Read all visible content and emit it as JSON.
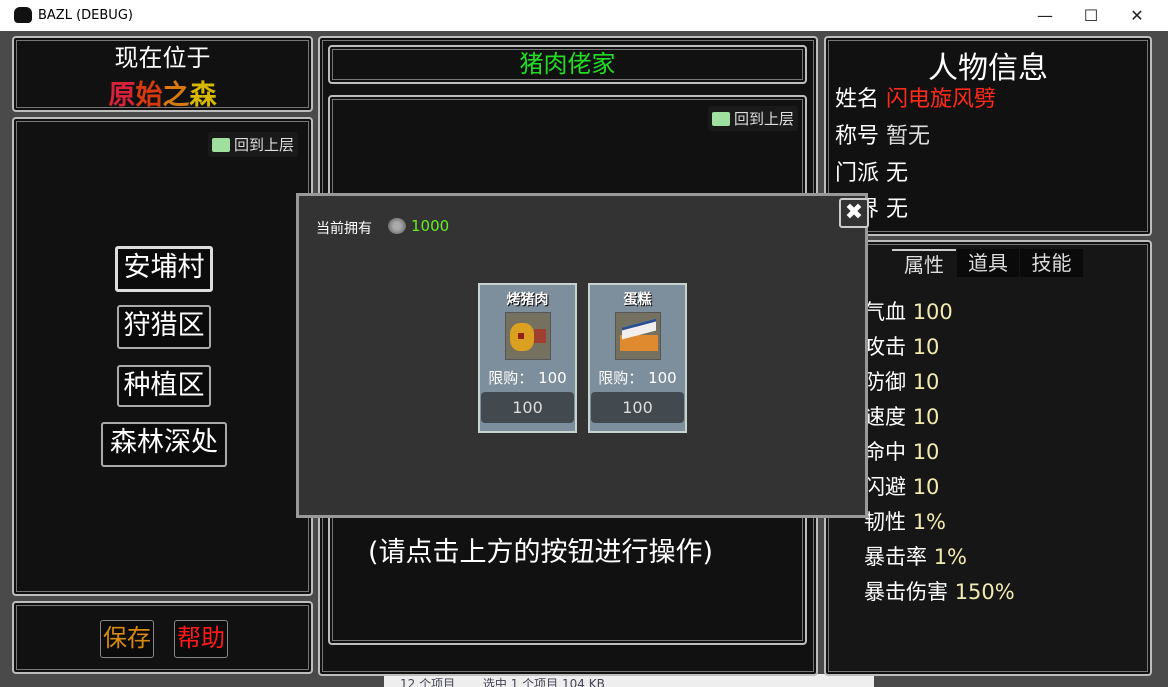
{
  "window": {
    "title": "BAZL (DEBUG)",
    "minimize": "—",
    "maximize": "☐",
    "close": "✕"
  },
  "location": {
    "heading": "现在位于",
    "name_chars": [
      "原",
      "始",
      "之",
      "森"
    ],
    "name_colors": [
      "#d8223a",
      "#d83a10",
      "#d87a10",
      "#d8b800"
    ]
  },
  "left": {
    "back_label": "回到上层",
    "places": [
      "安埔村",
      "狩猎区",
      "种植区",
      "森林深处"
    ],
    "selected": "安埔村"
  },
  "bottom": {
    "save": "保存",
    "help": "帮助",
    "save_color": "#d88a10",
    "help_color": "#ff1a1a"
  },
  "middle": {
    "title": "猪肉佬家",
    "title_color": "#22dd22",
    "back_label": "回到上层",
    "hint": "(请点击上方的按钮进行操作)"
  },
  "character": {
    "heading": "人物信息",
    "name_label": "姓名",
    "name_value": "闪电旋风劈",
    "title_label": "称号",
    "title_value": "暂无",
    "sect_label": "门派",
    "sect_value": "无",
    "realm_label": "境界",
    "realm_value": "无"
  },
  "tabs": [
    "属性",
    "道具",
    "技能"
  ],
  "active_tab": "属性",
  "stats": [
    {
      "label": "气血",
      "value": "100"
    },
    {
      "label": "攻击",
      "value": "10"
    },
    {
      "label": "防御",
      "value": "10"
    },
    {
      "label": "速度",
      "value": "10"
    },
    {
      "label": "命中",
      "value": "10"
    },
    {
      "label": "闪避",
      "value": "10"
    },
    {
      "label": "韧性",
      "value": "1%"
    },
    {
      "label": "暴击率",
      "value": "1%"
    },
    {
      "label": "暴击伤害",
      "value": "150%"
    }
  ],
  "shop": {
    "owned_label": "当前拥有",
    "coins": "1000",
    "coin_color": "#66ee22",
    "items": [
      {
        "name": "烤猪肉",
        "limit": "限购： 100",
        "price": "100",
        "icon": "roast-pork-icon"
      },
      {
        "name": "蛋糕",
        "limit": "限购： 100",
        "price": "100",
        "icon": "cake-icon"
      }
    ]
  },
  "statusbar": {
    "items": "12 个项目",
    "selected": "选中 1 个项目  104 KB"
  }
}
